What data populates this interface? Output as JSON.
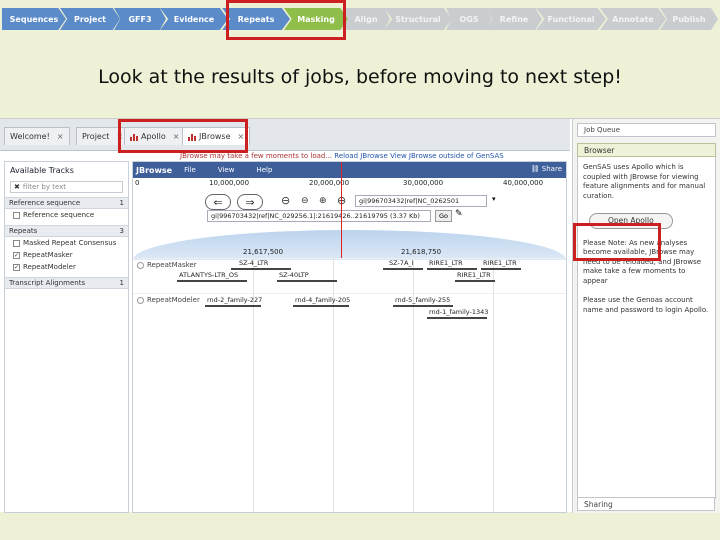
{
  "steps": [
    {
      "label": "Sequences",
      "state": "done"
    },
    {
      "label": "Project",
      "state": "done"
    },
    {
      "label": "GFF3",
      "state": "done"
    },
    {
      "label": "Evidence",
      "state": "done"
    },
    {
      "label": "Repeats",
      "state": "done"
    },
    {
      "label": "Masking",
      "state": "active"
    },
    {
      "label": "Align",
      "state": "todo"
    },
    {
      "label": "Structural",
      "state": "todo"
    },
    {
      "label": "OGS",
      "state": "todo"
    },
    {
      "label": "Refine",
      "state": "todo"
    },
    {
      "label": "Functional",
      "state": "todo"
    },
    {
      "label": "Annotate",
      "state": "todo"
    },
    {
      "label": "Publish",
      "state": "todo"
    }
  ],
  "headline": "Look at the results of jobs, before moving to next step!",
  "tabs": [
    {
      "label": "Welcome!",
      "close": "×"
    },
    {
      "label": "Project",
      "close": "×"
    },
    {
      "label": "Apollo",
      "close": "×"
    },
    {
      "label": "JBrowse",
      "close": "×"
    }
  ],
  "tracks_panel": {
    "title": "Available Tracks",
    "filter_placeholder": "filter by text",
    "group_reference": {
      "label": "Reference sequence",
      "count": "1"
    },
    "reference_item": "Reference sequence",
    "group_repeats": {
      "label": "Repeats",
      "count": "3"
    },
    "repeat_items": [
      "Masked Repeat Consensus",
      "RepeatMasker",
      "RepeatModeler"
    ],
    "group_alignments": {
      "label": "Transcript Alignments",
      "count": "1"
    }
  },
  "browser": {
    "loading_msg": "JBrowse may take a few moments to load...",
    "reload_link": "Reload JBrowse",
    "outside_link": "View JBrowse outside of GenSAS",
    "app_name": "JBrowse",
    "menu": [
      "File",
      "View",
      "Help"
    ],
    "share": "Share",
    "ruler": [
      "0",
      "10,000,000",
      "20,000,000",
      "30,000,000",
      "40,000,000"
    ],
    "refseq_box": "gi|996703432|ref|NC_0262501",
    "location": "gi|996703432|ref|NC_029256.1|:21619426..21619795 (3.37 Kb)",
    "go_label": "Go",
    "coord_left": "21,617,500",
    "coord_right": "21,618,750",
    "track_repeatmasker": "RepeatMasker",
    "track_repeatmodeler": "RepeatModeler",
    "features_top": [
      "SZ-4_LTR",
      "SZ-7A_I",
      "RIRE1_LTR",
      "RIRE1_LTR"
    ],
    "features_mid": [
      "ATLANTYS-LTR_OS",
      "SZ-40LTP",
      "RIRE1_LTR"
    ],
    "features_mod": [
      "rnd-2_family-227",
      "rnd-4_family-205",
      "rnd-5_family-255",
      "rnd-1_family-1343"
    ]
  },
  "sidebar": {
    "job_queue": "Job Queue",
    "browser_header": "Browser",
    "para1": "GenSAS uses Apollo which is coupled with JBrowse for viewing feature alignments and for manual curation.",
    "open_apollo": "Open Apollo",
    "para2": "Please Note: As new analyses become available, JBrowse may need to be reloaded, and JBrowse make take a few moments to appear",
    "para3": "Please use the Genoas account name and password to login Apollo.",
    "sharing": "Sharing"
  },
  "colors": {
    "highlight": "#cc1f1f",
    "done": "#5b8bc9",
    "active": "#8fbe4a",
    "todo": "#c9cdcf"
  }
}
